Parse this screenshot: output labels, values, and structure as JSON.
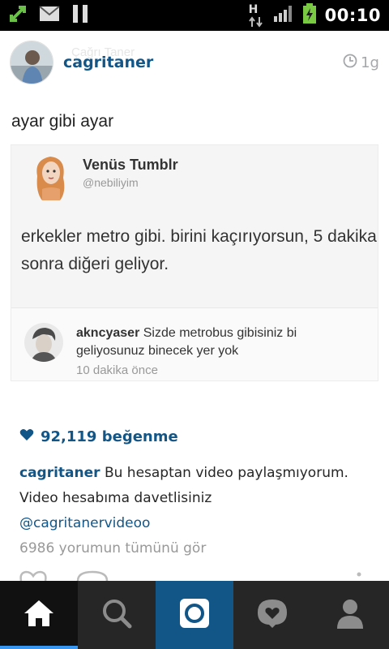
{
  "status_bar": {
    "time": "00:10",
    "network_type": "H",
    "icons": [
      "usb-icon",
      "mail-icon",
      "pause-icon",
      "network-arrows-icon",
      "signal-bars-icon",
      "battery-charging-icon"
    ]
  },
  "post": {
    "ghost_name": "Çağrı Taner",
    "username": "cagritaner",
    "time_ago": "1g",
    "image": {
      "caption": "ayar gibi ayar",
      "tweet": {
        "name": "Venüs Tumblr",
        "handle": "@nebiliyim",
        "text": "erkekler metro gibi. birini kaçırıyorsun, 5 dakika sonra diğeri geliyor."
      },
      "reply": {
        "user": "akncyaser",
        "text": " Sizde metrobus gibisiniz bi geliyosunuz binecek yer yok",
        "time": "10 dakika önce"
      }
    },
    "likes": "92,119 beğenme",
    "comment": {
      "user": "cagritaner",
      "text": " Bu hesaptan video paylaşmıyorum. Video hesabıma davetlisiniz",
      "mention": "@cagritanervideoo",
      "view_all": "6986 yorumun tümünü gör"
    }
  },
  "colors": {
    "link_blue": "#125688",
    "nav_bg": "#262626",
    "camera_bg": "#125688"
  },
  "bottom_nav": [
    "home-icon",
    "search-icon",
    "camera-icon",
    "activity-icon",
    "profile-icon"
  ]
}
